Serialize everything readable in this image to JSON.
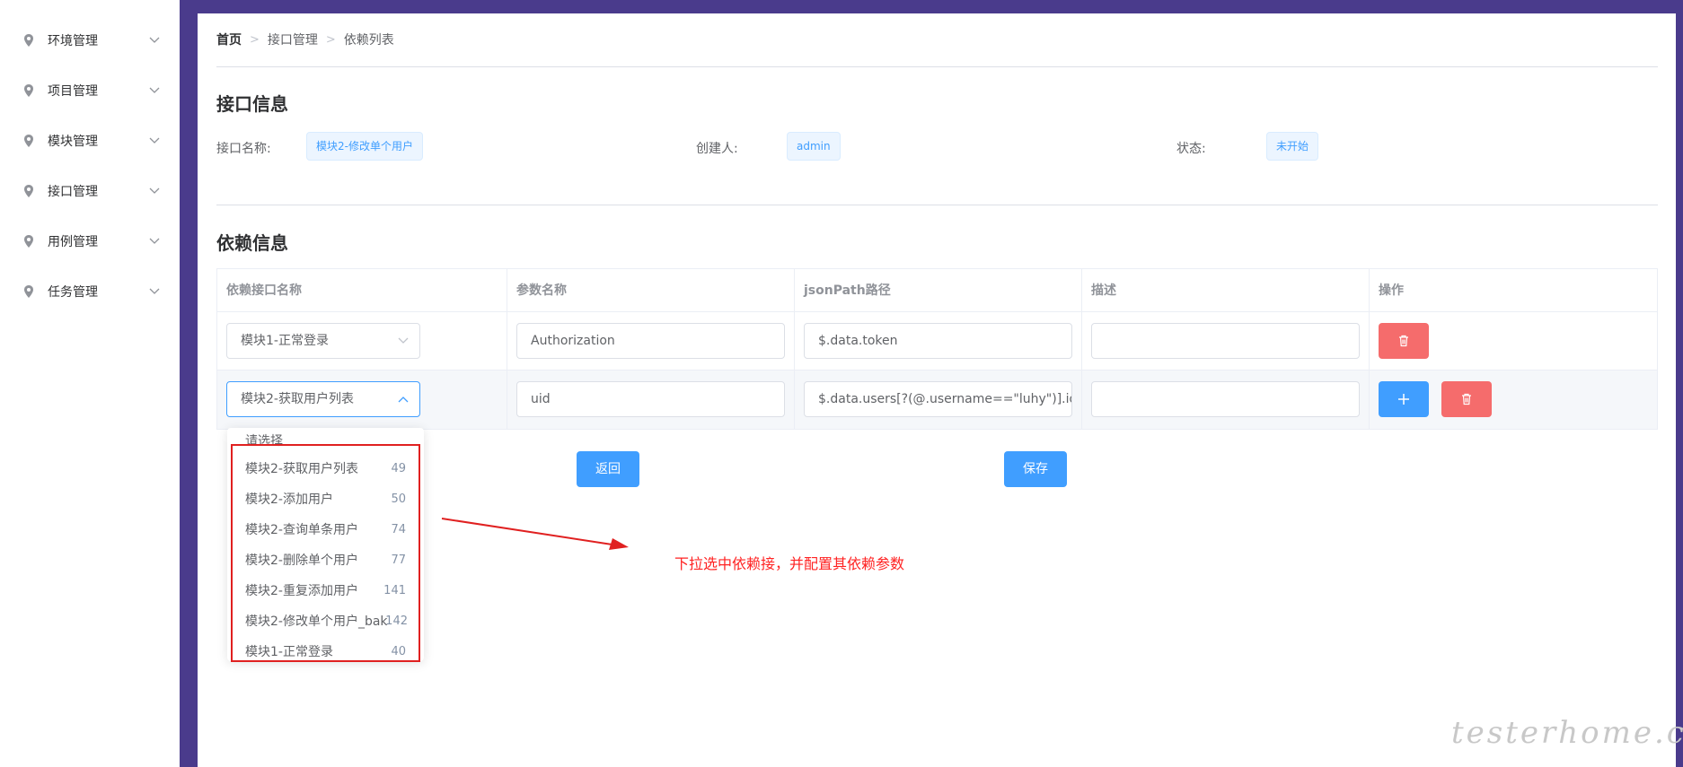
{
  "sidebar": {
    "items": [
      {
        "label": "环境管理",
        "icon": "location-pin-icon"
      },
      {
        "label": "项目管理",
        "icon": "location-pin-icon"
      },
      {
        "label": "模块管理",
        "icon": "location-pin-icon"
      },
      {
        "label": "接口管理",
        "icon": "location-pin-icon"
      },
      {
        "label": "用例管理",
        "icon": "location-pin-icon"
      },
      {
        "label": "任务管理",
        "icon": "location-pin-icon"
      }
    ]
  },
  "breadcrumb": {
    "home": "首页",
    "level1": "接口管理",
    "current": "依赖列表",
    "separator": ">"
  },
  "interface_info": {
    "title": "接口信息",
    "name_label": "接口名称:",
    "name_value": "模块2-修改单个用户",
    "creator_label": "创建人:",
    "creator_value": "admin",
    "status_label": "状态:",
    "status_value": "未开始"
  },
  "dependency_info": {
    "title": "依赖信息",
    "columns": [
      "依赖接口名称",
      "参数名称",
      "jsonPath路径",
      "描述",
      "操作"
    ],
    "rows": [
      {
        "interface": "模块1-正常登录",
        "param": "Authorization",
        "jsonpath": "$.data.token",
        "desc": ""
      },
      {
        "interface": "模块2-获取用户列表",
        "param": "uid",
        "jsonpath": "$.data.users[?(@.username==\"luhy\")].id",
        "desc": ""
      }
    ]
  },
  "buttons": {
    "back": "返回",
    "save": "保存",
    "add_icon": "plus-icon",
    "delete_icon": "trash-icon"
  },
  "dropdown": {
    "options": [
      {
        "label": "请选择",
        "num": ""
      },
      {
        "label": "模块2-获取用户列表",
        "num": "49"
      },
      {
        "label": "模块2-添加用户",
        "num": "50"
      },
      {
        "label": "模块2-查询单条用户",
        "num": "74"
      },
      {
        "label": "模块2-删除单个用户",
        "num": "77"
      },
      {
        "label": "模块2-重复添加用户",
        "num": "141"
      },
      {
        "label": "模块2-修改单个用户_bak",
        "num": "142"
      },
      {
        "label": "模块1-正常登录",
        "num": "40"
      }
    ]
  },
  "annotation": {
    "text": "下拉选中依赖接，并配置其依赖参数"
  },
  "watermark": "testerhome.com",
  "colors": {
    "primary": "#409eff",
    "danger": "#f56c6c",
    "page_bg": "#4a3b8c",
    "annotation": "#ff2222"
  }
}
